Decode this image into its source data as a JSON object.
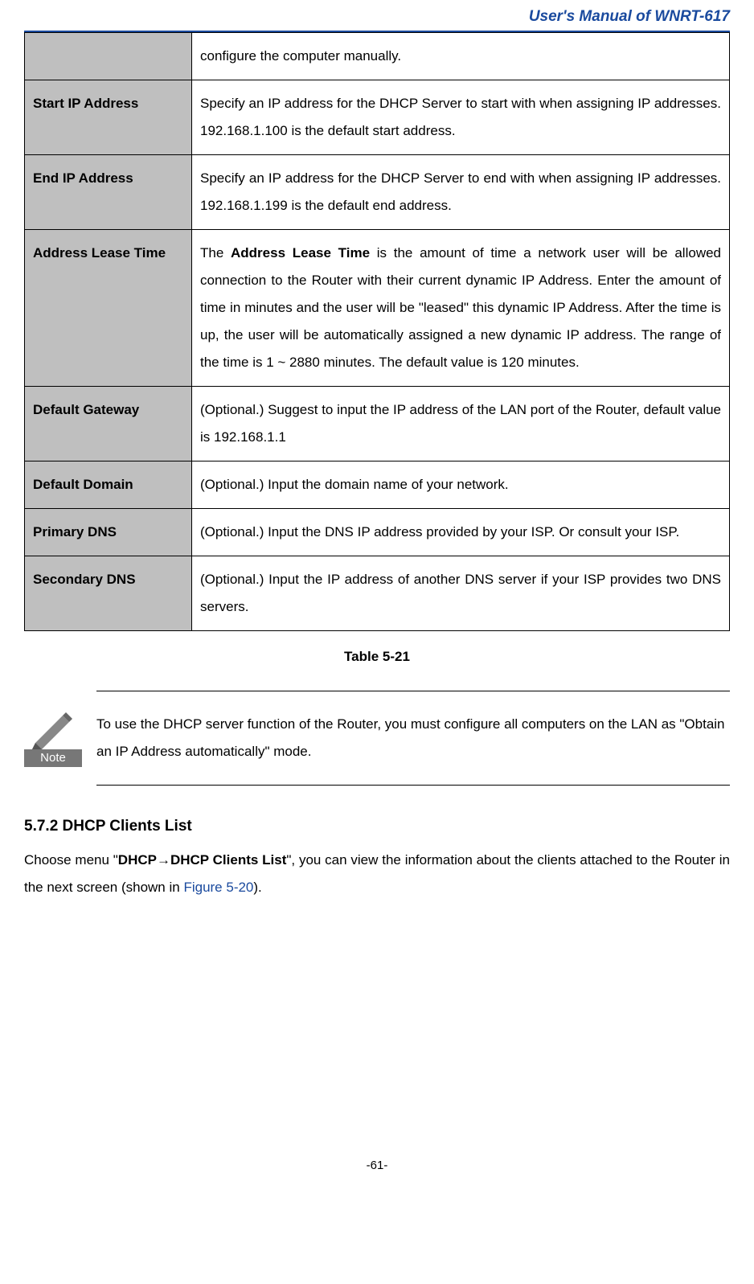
{
  "header": {
    "title": "User's Manual of WNRT-617"
  },
  "table": {
    "rows": [
      {
        "label": "",
        "desc": "configure the computer manually.",
        "smallFont": false
      },
      {
        "label": "Start IP Address",
        "desc": "Specify an IP address for the DHCP Server to start with when assigning IP addresses. 192.168.1.100 is the default start address.",
        "smallFont": true
      },
      {
        "label": "End IP Address",
        "desc": "Specify an IP address for the DHCP Server to end with when assigning IP addresses. 192.168.1.199 is the default end address.",
        "smallFont": false
      },
      {
        "label": "Address Lease Time",
        "desc_prefix": "The ",
        "desc_bold": "Address Lease Time",
        "desc_suffix": " is the amount of time a network user will be allowed connection to the Router with their current dynamic IP Address. Enter the amount of time in minutes and the user will be \"leased\" this dynamic IP Address. After the time is up, the user will be automatically assigned a new dynamic IP address. The range of the time is 1 ~ 2880 minutes. The default value is 120 minutes.",
        "smallFont": false
      },
      {
        "label": "Default Gateway",
        "desc": "(Optional.) Suggest to input the IP address of the LAN port of the Router, default value is 192.168.1.1",
        "smallFont": false
      },
      {
        "label": "Default Domain",
        "desc": "(Optional.) Input the domain name of your network.",
        "smallFont": false
      },
      {
        "label": "Primary DNS",
        "desc": "(Optional.) Input the DNS IP address provided by your ISP. Or consult your ISP.",
        "smallFont": false
      },
      {
        "label": "Secondary DNS",
        "desc": "(Optional.) Input the IP address of another DNS server if your ISP provides two DNS servers.",
        "smallFont": false
      }
    ],
    "caption": "Table 5-21"
  },
  "note": {
    "iconLabel": "Note",
    "text": "To use the DHCP server function of the Router, you must configure all computers on the LAN as \"Obtain an IP Address automatically\" mode."
  },
  "section": {
    "heading": "5.7.2   DHCP Clients List",
    "body_prefix": "Choose menu \"",
    "body_bold": "DHCP→DHCP Clients List",
    "body_mid": "\", you can view the information about the clients attached to the Router in the next screen (shown in ",
    "body_link": "Figure 5-20",
    "body_suffix": ")."
  },
  "pageNumber": "-61-"
}
